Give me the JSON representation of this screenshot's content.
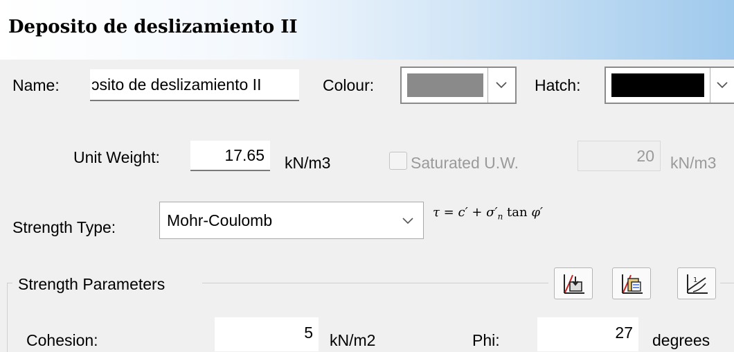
{
  "window": {
    "title": "Deposito de deslizamiento II"
  },
  "name_field": {
    "label": "Name:",
    "value": "ɔsito de deslizamiento II"
  },
  "colour": {
    "label": "Colour:",
    "value": "#8a8a8a"
  },
  "hatch": {
    "label": "Hatch:",
    "value": "#000000"
  },
  "unit_weight": {
    "label": "Unit Weight:",
    "value": "17.65",
    "unit": "kN/m3"
  },
  "saturated": {
    "label": "Saturated U.W.",
    "checked": false,
    "value": "20",
    "unit": "kN/m3"
  },
  "strength_type": {
    "label": "Strength Type:",
    "value": "Mohr-Coulomb"
  },
  "formula": {
    "lhs": "τ = c′ + σ′",
    "sub": "n",
    "tan": " tan ",
    "phi": "φ′"
  },
  "strength_params": {
    "group_label": "Strength Parameters"
  },
  "toolbar": {
    "icons": [
      "import-function-icon",
      "copy-function-icon",
      "graph-edit-icon"
    ]
  },
  "cohesion": {
    "label": "Cohesion:",
    "value": "5",
    "unit": "kN/m2"
  },
  "phi": {
    "label": "Phi:",
    "value": "27",
    "unit": "degrees"
  }
}
